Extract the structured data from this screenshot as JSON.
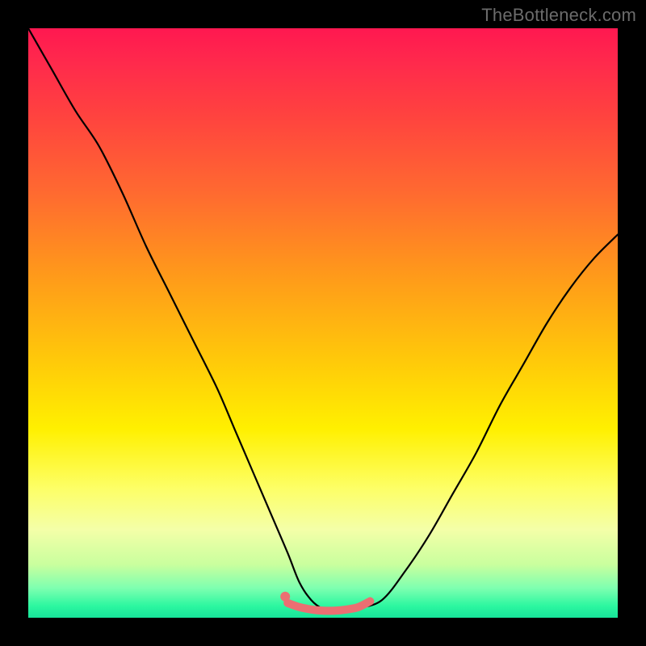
{
  "watermark": "TheBottleneck.com",
  "chart_data": {
    "type": "line",
    "title": "",
    "xlabel": "",
    "ylabel": "",
    "xlim": [
      0,
      100
    ],
    "ylim": [
      0,
      100
    ],
    "series": [
      {
        "name": "bottleneck-curve",
        "x": [
          0,
          4,
          8,
          12,
          16,
          20,
          24,
          28,
          32,
          35,
          38,
          41,
          44,
          46,
          48,
          50,
          52,
          54,
          56,
          60,
          64,
          68,
          72,
          76,
          80,
          84,
          88,
          92,
          96,
          100
        ],
        "values": [
          100,
          93,
          86,
          80,
          72,
          63,
          55,
          47,
          39,
          32,
          25,
          18,
          11,
          6,
          3,
          1.5,
          1.2,
          1.2,
          1.6,
          3,
          8,
          14,
          21,
          28,
          36,
          43,
          50,
          56,
          61,
          65
        ]
      },
      {
        "name": "sweet-spot-band",
        "x": [
          44,
          46,
          48,
          50,
          52,
          54,
          56,
          58
        ],
        "values": [
          2.5,
          1.8,
          1.4,
          1.2,
          1.2,
          1.4,
          1.8,
          2.8
        ]
      }
    ],
    "accent_color": "#eb6f72",
    "curve_color": "#000000"
  }
}
